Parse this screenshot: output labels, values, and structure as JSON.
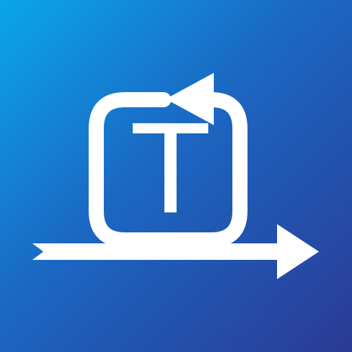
{
  "icon": {
    "letter": "T",
    "name": "rotation-loop-logo",
    "colors": {
      "gradient_start": "#0aa6ea",
      "gradient_mid": "#1b67c2",
      "gradient_end": "#2b3a95",
      "foreground": "#ffffff"
    }
  }
}
